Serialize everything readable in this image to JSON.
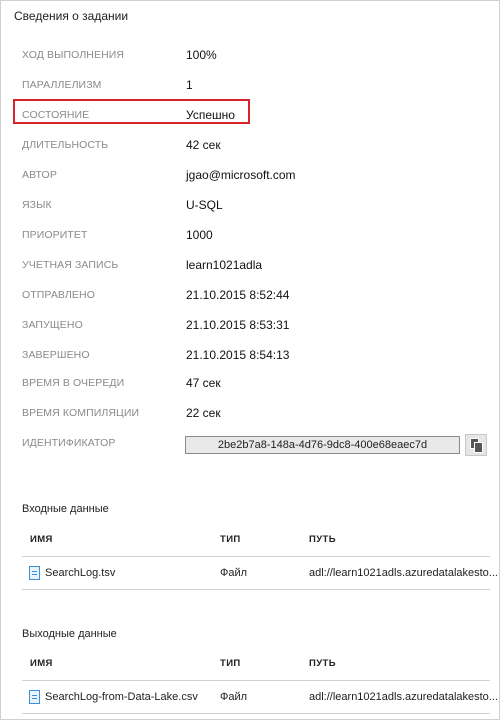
{
  "panel": {
    "title": "Сведения о задании"
  },
  "properties": [
    {
      "label": "ХОД ВЫПОЛНЕНИЯ",
      "value": "100%"
    },
    {
      "label": "ПАРАЛЛЕЛИЗМ",
      "value": "1"
    },
    {
      "label": "СОСТОЯНИЕ",
      "value": "Успешно"
    },
    {
      "label": "ДЛИТЕЛЬНОСТЬ",
      "value": "42 сек"
    },
    {
      "label": "АВТОР",
      "value": "jgao@microsoft.com"
    },
    {
      "label": "ЯЗЫК",
      "value": "U-SQL"
    },
    {
      "label": "ПРИОРИТЕТ",
      "value": "1000"
    },
    {
      "label": "УЧЕТНАЯ ЗАПИСЬ",
      "value": "learn1021adla"
    },
    {
      "label": "ОТПРАВЛЕНО",
      "value": "21.10.2015 8:52:44"
    },
    {
      "label": "ЗАПУЩЕНО",
      "value": "21.10.2015 8:53:31"
    },
    {
      "label": "ЗАВЕРШЕНО",
      "value": "21.10.2015 8:54:13"
    },
    {
      "label": "ВРЕМЯ В ОЧЕРЕДИ",
      "value": "47 сек"
    },
    {
      "label": "ВРЕМЯ КОМПИЛЯЦИИ",
      "value": "22 сек"
    }
  ],
  "identifier": {
    "label": "ИДЕНТИФИКАТОР",
    "value": "2be2b7a8-148a-4d76-9dc8-400e68eaec7d",
    "copy_icon": "copy-icon"
  },
  "highlight_color": "#d8232a",
  "inputs": {
    "title": "Входные данные",
    "columns": {
      "name": "ИМЯ",
      "type": "ТИП",
      "path": "ПУТЬ"
    },
    "rows": [
      {
        "name": "SearchLog.tsv",
        "type": "Файл",
        "path": "adl://learn1021adls.azuredatalakesto..."
      }
    ]
  },
  "outputs": {
    "title": "Выходные данные",
    "columns": {
      "name": "ИМЯ",
      "type": "ТИП",
      "path": "ПУТЬ"
    },
    "rows": [
      {
        "name": "SearchLog-from-Data-Lake.csv",
        "type": "Файл",
        "path": "adl://learn1021adls.azuredatalakesto..."
      }
    ]
  }
}
